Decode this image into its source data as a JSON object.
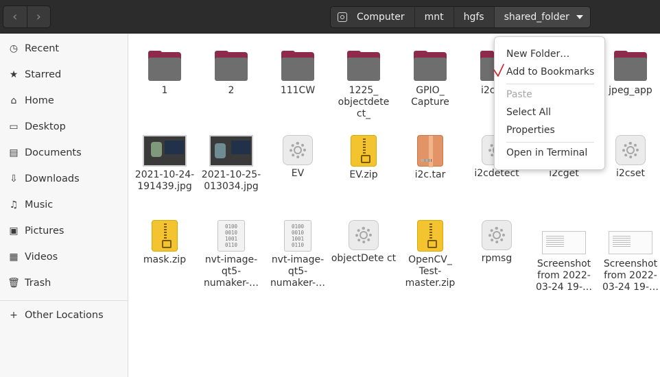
{
  "header": {
    "back_glyph": "‹",
    "forward_glyph": "›",
    "breadcrumbs": [
      "Computer",
      "mnt",
      "hgfs",
      "shared_folder"
    ]
  },
  "sidebar": {
    "items": [
      {
        "label": "Recent",
        "icon": "clock-icon",
        "glyph": "◷"
      },
      {
        "label": "Starred",
        "icon": "star-icon",
        "glyph": "★"
      },
      {
        "label": "Home",
        "icon": "home-icon",
        "glyph": "⌂"
      },
      {
        "label": "Desktop",
        "icon": "desktop-icon",
        "glyph": "▭"
      },
      {
        "label": "Documents",
        "icon": "documents-icon",
        "glyph": "▤"
      },
      {
        "label": "Downloads",
        "icon": "download-icon",
        "glyph": "⇩"
      },
      {
        "label": "Music",
        "icon": "music-icon",
        "glyph": "♫"
      },
      {
        "label": "Pictures",
        "icon": "pictures-icon",
        "glyph": "▣"
      },
      {
        "label": "Videos",
        "icon": "videos-icon",
        "glyph": "▦"
      },
      {
        "label": "Trash",
        "icon": "trash-icon",
        "glyph": "🗑"
      }
    ],
    "other_locations": {
      "label": "Other Locations",
      "glyph": "+"
    }
  },
  "files": [
    {
      "label": "1",
      "type": "folder"
    },
    {
      "label": "2",
      "type": "folder"
    },
    {
      "label": "111CW",
      "type": "folder"
    },
    {
      "label": "1225_ objectdete ct_",
      "type": "folder"
    },
    {
      "label": "GPIO_ Capture",
      "type": "folder"
    },
    {
      "label": "i2c_ te",
      "type": "folder"
    },
    {
      "label": "jpeg_app",
      "type": "folder"
    },
    {
      "label": "2021-10-24- 191439.jpg",
      "type": "image"
    },
    {
      "label": "2021-10-25- 013034.jpg",
      "type": "image"
    },
    {
      "label": "EV",
      "type": "executable"
    },
    {
      "label": "EV.zip",
      "type": "zip"
    },
    {
      "label": "i2c.tar",
      "type": "tar"
    },
    {
      "label": "i2cdetect",
      "type": "executable"
    },
    {
      "label": "i2cget",
      "type": "executable"
    },
    {
      "label": "i2cset",
      "type": "executable"
    },
    {
      "label": "mask.zip",
      "type": "zip"
    },
    {
      "label": "nvt-image- qt5- numaker-…",
      "type": "binary"
    },
    {
      "label": "nvt-image- qt5- numaker-…",
      "type": "binary"
    },
    {
      "label": "objectDete ct",
      "type": "executable"
    },
    {
      "label": "OpenCV_ Test- master.zip",
      "type": "zip"
    },
    {
      "label": "rpmsg",
      "type": "executable"
    },
    {
      "label": "Screenshot from 2022- 03-24 19-…",
      "type": "screenshot"
    },
    {
      "label": "Screenshot from 2022- 03-24 19-…",
      "type": "screenshot"
    }
  ],
  "binary_icon_text": "0100\n0010\n1001\n0110",
  "context_menu": {
    "items": [
      "New Folder…",
      "Add to Bookmarks",
      "Paste",
      "Select All",
      "Properties",
      "Open in Terminal"
    ],
    "disabled": [
      "Paste"
    ]
  },
  "colors": {
    "headerbar": "#2c2c2c",
    "folder_tab": "#8e2a4b",
    "folder_body": "#6e6e6e",
    "annotation": "#d0202a"
  }
}
